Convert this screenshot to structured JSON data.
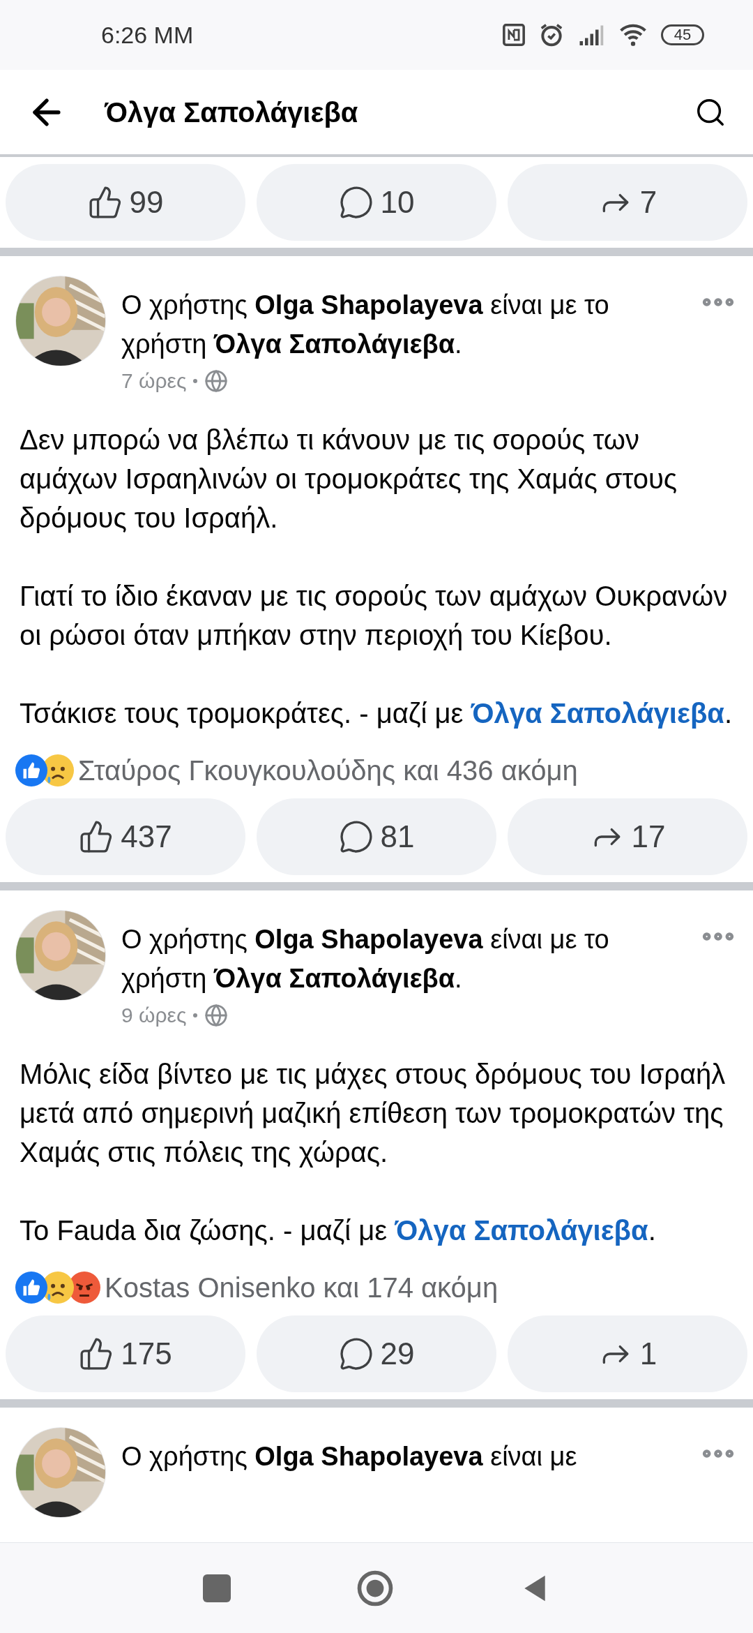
{
  "status_bar": {
    "time": "6:26 MM",
    "battery": "45"
  },
  "header": {
    "title": "Όλγα Σαπολάγιεβα"
  },
  "posts": [
    {
      "actions": [
        {
          "kind": "like",
          "count": "99"
        },
        {
          "kind": "comment",
          "count": "10"
        },
        {
          "kind": "share",
          "count": "7"
        }
      ]
    },
    {
      "author_line": "Ο χρήστης **Olga Shapolayeva** είναι με το χρήστη **Όλγα Σαπολάγιεβα**.",
      "time": "7 ώρες",
      "paragraphs": [
        {
          "text": "Δεν μπορώ να βλέπω τι κάνουν με τις σορούς των αμάχων Ισραηλινών οι τρομοκράτες της Χαμάς στους δρόμους του Ισραήλ."
        },
        {
          "text": "Γιατί το ίδιο έκαναν με τις σορούς των αμάχων Ουκρανών οι ρώσοι όταν μπήκαν στην περιοχή του Κίεβου."
        },
        {
          "text": "Τσάκισε τους τρομοκράτες. - μαζί με",
          "link": "Όλγα Σαπολάγιεβα",
          "after": "."
        }
      ],
      "reactions": [
        {
          "kind": "like"
        },
        {
          "kind": "sad"
        }
      ],
      "reaction_text": "Σταύρος Γκουγκουλούδης και 436 ακόμη",
      "actions": [
        {
          "kind": "like",
          "count": "437"
        },
        {
          "kind": "comment",
          "count": "81"
        },
        {
          "kind": "share",
          "count": "17"
        }
      ]
    },
    {
      "author_line": "Ο χρήστης **Olga Shapolayeva** είναι με το χρήστη **Όλγα Σαπολάγιεβα**.",
      "time": "9 ώρες",
      "paragraphs": [
        {
          "text": "Μόλις είδα βίντεο με τις μάχες στους δρόμους του Ισραήλ μετά από σημερινή μαζική επίθεση των τρομοκρατών της Χαμάς στις πόλεις της χώρας."
        },
        {
          "text": "Το Fauda δια ζώσης. - μαζί με",
          "link": "Όλγα Σαπολάγιεβα",
          "after": "."
        }
      ],
      "reactions": [
        {
          "kind": "like"
        },
        {
          "kind": "sad"
        },
        {
          "kind": "angry"
        }
      ],
      "reaction_text": "Kostas Onisenko και 174 ακόμη",
      "actions": [
        {
          "kind": "like",
          "count": "175"
        },
        {
          "kind": "comment",
          "count": "29"
        },
        {
          "kind": "share",
          "count": "1"
        }
      ]
    },
    {
      "author_line": "Ο χρήστης **Olga Shapolayeva** είναι με"
    }
  ]
}
